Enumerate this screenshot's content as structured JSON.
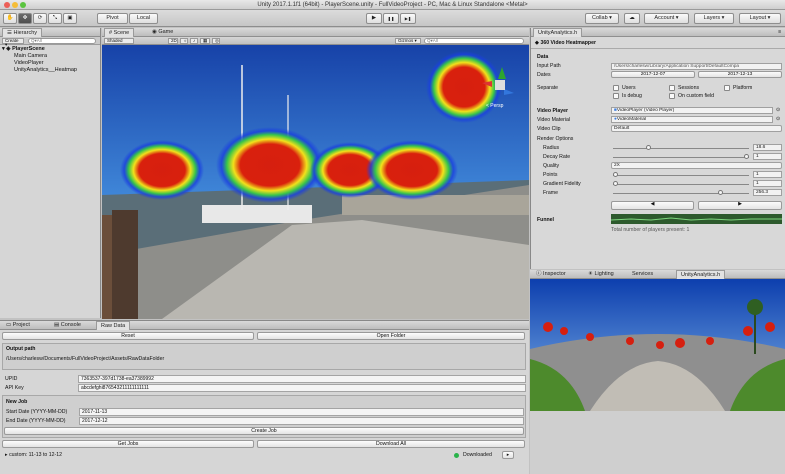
{
  "window": {
    "title": "Unity 2017.1.1f1 (64bit) - PlayerScene.unity - FullVideoProject - PC, Mac & Linux Standalone <Metal>"
  },
  "toolbar": {
    "pivot": "Pivot",
    "local": "Local",
    "collab": "Collab ▾",
    "account": "Account ▾",
    "layers": "Layers ▾",
    "layout": "Layout ▾",
    "play_icon": "▶",
    "pause_icon": "❚❚",
    "step_icon": "▶❚"
  },
  "hierarchy": {
    "tab": "Hierarchy",
    "create": "Create ▾",
    "search_placeholder": "Q▾All",
    "scene": "PlayerScene",
    "items": [
      "Main Camera",
      "VideoPlayer",
      "UnityAnalytics__Heatmap"
    ]
  },
  "scene": {
    "tabs": [
      "Scene",
      "Game"
    ],
    "shading": "Shaded",
    "mode2d": "2D",
    "gizmos": "Gizmos ▾",
    "search_placeholder": "Q▾All",
    "gizmo_label": "< Persp"
  },
  "analytics": {
    "tab": "UnityAnalytics.h",
    "title": "360 Video Heatmapper",
    "data_header": "Data",
    "input_path_label": "Input Path",
    "input_path_value": "/Users/charlesw/Library/Application Support/DefaultCompa",
    "dates_label": "Dates",
    "date_start": "2017-12-07",
    "date_end": "2017-12-13",
    "separate_label": "Separate",
    "sep_users": "Users",
    "sep_sessions": "Sessions",
    "sep_platform": "Platform",
    "sep_debug": "Is debug",
    "sep_custom": "On custom field",
    "video_player_header": "Video Player",
    "video_player_value": "VideoPlayer (Video Player)",
    "video_material_label": "Video Material",
    "video_material_value": "VideoMaterial",
    "video_clip_label": "Video Clip",
    "video_clip_value": "Default",
    "render_options_label": "Render Options",
    "radius_label": "Radius",
    "radius_value": "18.6",
    "radius_level": 0.25,
    "decay_label": "Decay Rate",
    "decay_value": "1",
    "decay_level": 1.0,
    "quality_label": "Quality",
    "quality_value": "2X",
    "points_label": "Points",
    "points_value": "1",
    "points_level": 0.0,
    "gradient_label": "Gradient Fidelity",
    "gradient_value": "1",
    "gradient_level": 0.0,
    "frame_label": "Frame",
    "frame_value": "256.3",
    "frame_level": 0.8,
    "funnel_label": "Funnel",
    "funnel_caption": "Total number of players present: 1"
  },
  "inspector_tabs": [
    "Inspector",
    "Lighting",
    "Services",
    "UnityAnalytics.h"
  ],
  "bottom": {
    "tabs": [
      "Project",
      "Console",
      "Raw Data"
    ],
    "reset": "Reset",
    "open_folder": "Open Folder",
    "output_path_header": "Output path",
    "output_path_value": "/Users/charlesw/Documents/FullVideoProject/Assets/RawDataFolder",
    "upid_label": "UPID",
    "upid_value": "7363537-397d1738-ea37389992",
    "api_key_label": "API Key",
    "api_key_value": "abcdefghi876543211111111111",
    "new_job_header": "New Job",
    "start_date_label": "Start Date (YYYY-MM-DD)",
    "start_date_value": "2017-11-13",
    "end_date_label": "End Date (YYYY-MM-DD)",
    "end_date_value": "2017-12-12",
    "create_job": "Create Job",
    "get_jobs": "Get Jobs",
    "download_all": "Download All",
    "job_item": "custom: 11-13 to 12-12",
    "job_status": "Downloaded",
    "status_color": "#29b34a"
  },
  "colors": {
    "accent": "#3d7ee0",
    "heat_core": "#d61f0f",
    "heat_mid": "#f2e11b",
    "heat_outer": "#1a3fe0"
  }
}
